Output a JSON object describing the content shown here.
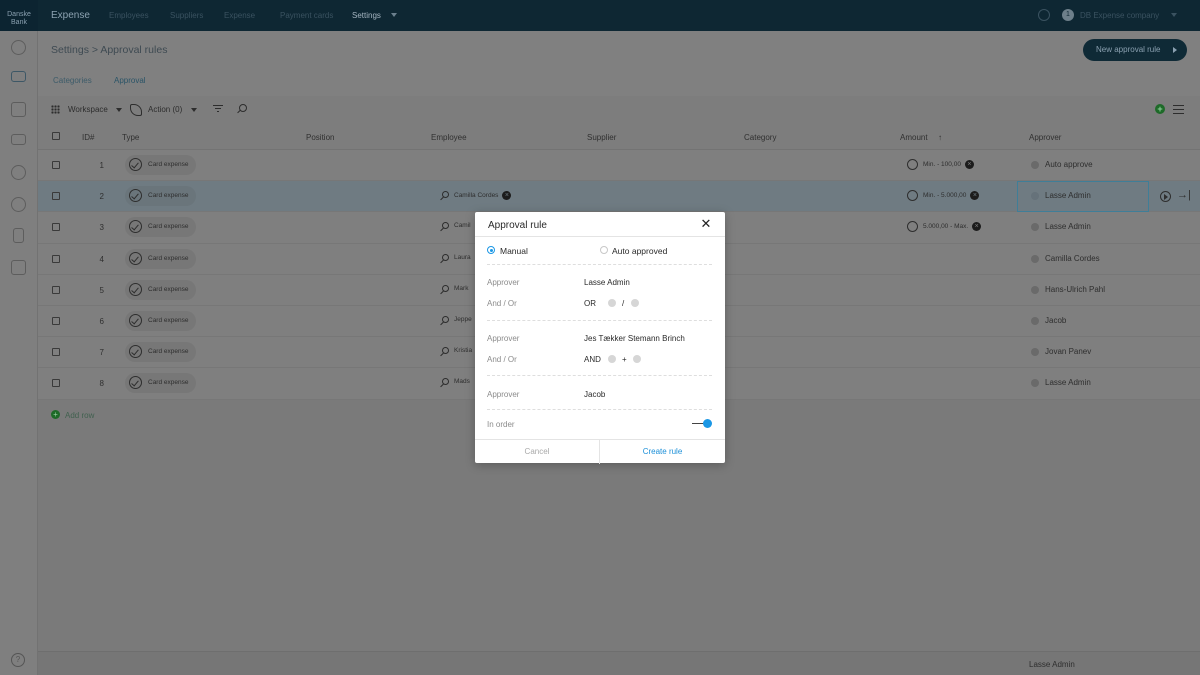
{
  "app": {
    "bank_logo": "Danske Bank",
    "title": "Expense",
    "nav": [
      "Employees",
      "Suppliers",
      "Expense",
      "Payment cards",
      "Settings"
    ],
    "notification_count": "1",
    "company": "DB Expense company"
  },
  "page": {
    "breadcrumb": "Settings >  Approval rules",
    "new_rule_button": "New approval rule",
    "tabs": [
      "Categories",
      "Approval"
    ]
  },
  "toolbar": {
    "workspace": "Workspace",
    "action": "Action (0)"
  },
  "table": {
    "columns": [
      "ID#",
      "Type",
      "Position",
      "Employee",
      "Supplier",
      "Category",
      "Amount",
      "Approver"
    ],
    "rows": [
      {
        "id": "1",
        "type": "Card expense",
        "employee": "",
        "amount": "Min. - 100,00",
        "approver": "Auto approve"
      },
      {
        "id": "2",
        "type": "Card expense",
        "employee": "Camilla Cordes",
        "amount": "Min. - 5.000,00",
        "approver": "Lasse Admin"
      },
      {
        "id": "3",
        "type": "Card expense",
        "employee": "Camil",
        "amount": "5.000,00 - Max.",
        "approver": "Lasse Admin"
      },
      {
        "id": "4",
        "type": "Card expense",
        "employee": "Laura",
        "amount": "",
        "approver": "Camilla Cordes"
      },
      {
        "id": "5",
        "type": "Card expense",
        "employee": "Mark",
        "amount": "",
        "approver": "Hans-Ulrich Pahl"
      },
      {
        "id": "6",
        "type": "Card expense",
        "employee": "Jeppe",
        "amount": "",
        "approver": "Jacob"
      },
      {
        "id": "7",
        "type": "Card expense",
        "employee": "Kristia",
        "amount": "",
        "approver": "Jovan Panev"
      },
      {
        "id": "8",
        "type": "Card expense",
        "employee": "Mads",
        "amount": "",
        "approver": "Lasse Admin"
      }
    ],
    "add_row": "Add row",
    "footer_text": "Lasse Admin"
  },
  "modal": {
    "title": "Approval rule",
    "close_symbol": "✕",
    "manual_label": "Manual",
    "auto_label": "Auto approved",
    "approver_label": "Approver",
    "andor_label": "And / Or",
    "approver1": "Lasse Admin",
    "op1": "OR",
    "op1_sym": "/",
    "approver2": "Jes Tækker Stemann Brinch",
    "op2": "AND",
    "op2_sym": "+",
    "approver3": "Jacob",
    "in_order_label": "In order",
    "cancel": "Cancel",
    "create": "Create rule"
  },
  "colors": {
    "accent": "#1b97e5",
    "topbar": "#0e2733",
    "add_green": "#1d6a28"
  }
}
